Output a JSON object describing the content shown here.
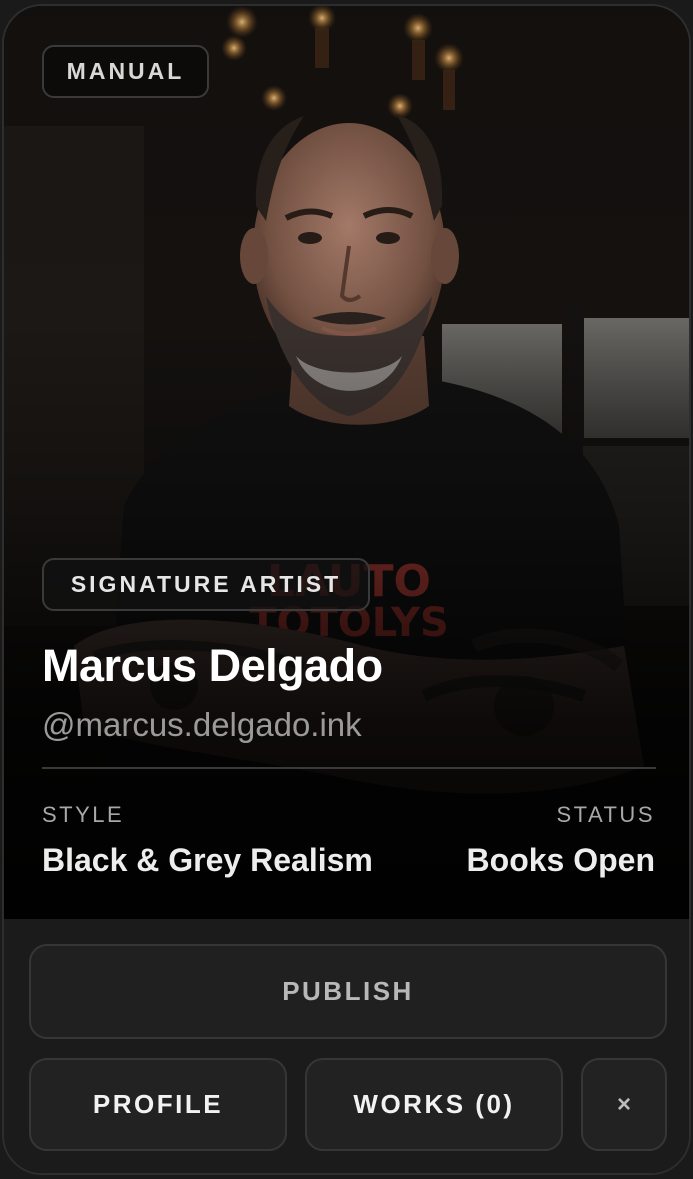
{
  "badge": "MANUAL",
  "artist": {
    "title": "SIGNATURE ARTIST",
    "name": "Marcus Delgado",
    "handle": "@marcus.delgado.ink"
  },
  "details": {
    "style_label": "STYLE",
    "style_value": "Black & Grey Realism",
    "status_label": "STATUS",
    "status_value": "Books Open"
  },
  "actions": {
    "publish": "PUBLISH",
    "profile": "PROFILE",
    "works": "WORKS (0)",
    "close": "×"
  },
  "icons": {
    "close": "close-icon"
  },
  "colors": {
    "background": "#1a1a1a",
    "card": "#0b0b0b",
    "button_bg": "#222222",
    "border": "#363636",
    "muted_text": "#9a9a9a"
  }
}
